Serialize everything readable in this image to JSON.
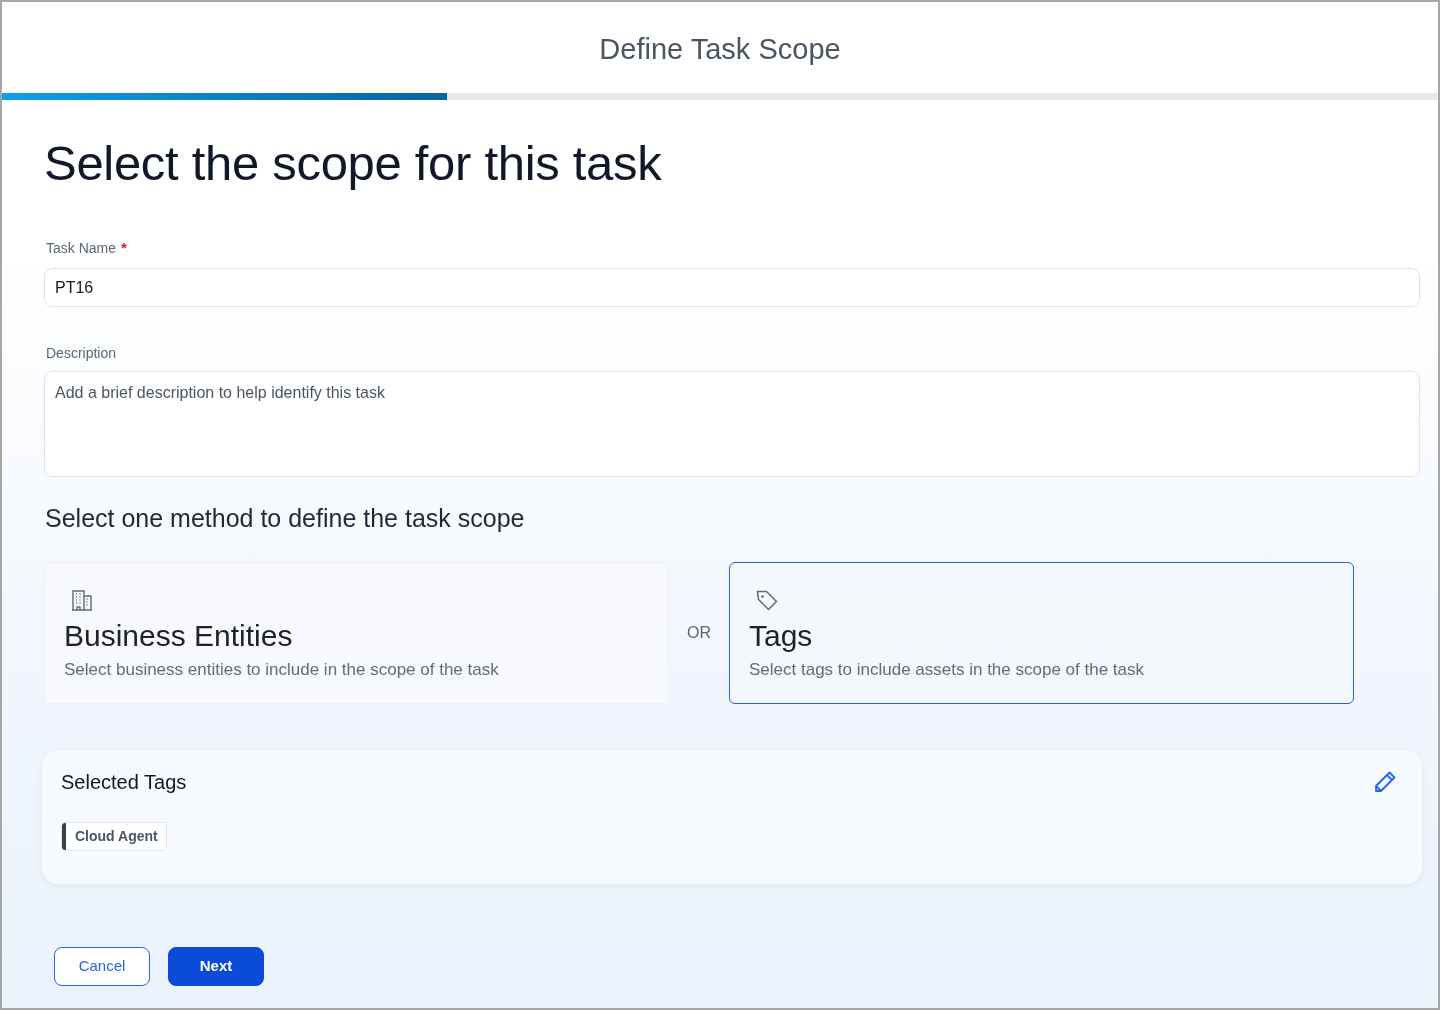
{
  "header": {
    "title": "Define Task Scope",
    "progress": {
      "level": 0.31
    }
  },
  "heading": "Select the scope for this task",
  "fields": [
    {
      "kind": "input",
      "label": "Task Name",
      "required_mark": "*",
      "value": "PT16"
    },
    {
      "kind": "textarea",
      "label": "Description",
      "placeholder": "Add a brief description to help identify this task"
    }
  ],
  "method_section": {
    "title": "Select one method to define the task scope",
    "separator": "OR",
    "options": [
      {
        "kind": "entities",
        "title": "Business Entities",
        "description": "Select business entities to include in the scope of the task",
        "selected": false
      },
      {
        "kind": "tags",
        "title": "Tags",
        "description": "Select tags to include assets in the scope of the task",
        "selected": true
      }
    ]
  },
  "selected_tags": {
    "title": "Selected Tags",
    "tags": [
      {
        "label": "Cloud Agent",
        "color": "#36434d"
      }
    ]
  },
  "buttons": [
    {
      "kind": "secondary",
      "label": "Cancel"
    },
    {
      "kind": "primary",
      "label": "Next"
    }
  ]
}
